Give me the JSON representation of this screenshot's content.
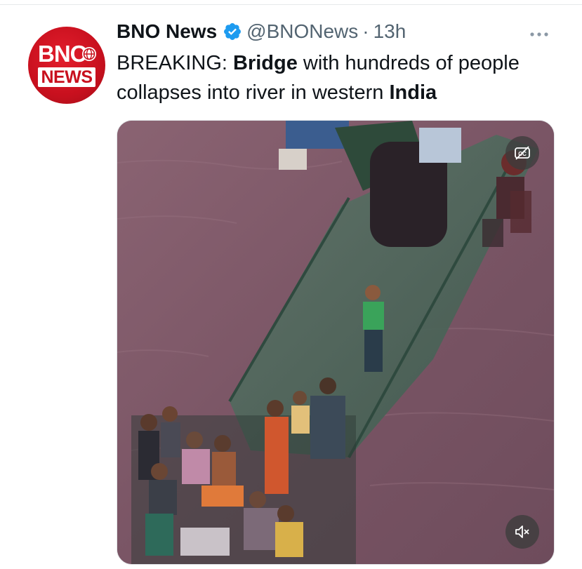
{
  "account": {
    "name": "BNO News",
    "handle": "@BNONews",
    "separator": "·",
    "time": "13h",
    "avatar_text_top": "BNO",
    "avatar_text_bottom": "NEWS",
    "brand_color": "#c8101e",
    "verified_color": "#1d9bf0"
  },
  "tweet": {
    "parts": [
      {
        "text": "BREAKING: ",
        "bold": false
      },
      {
        "text": "Bridge",
        "bold": true
      },
      {
        "text": " with hundreds of people collapses into river in western ",
        "bold": false
      },
      {
        "text": "India",
        "bold": true
      }
    ]
  },
  "media": {
    "type": "video",
    "description_icon": "captions-off-icon",
    "volume_icon": "muted-speaker-icon"
  },
  "icons": {
    "more": "more-horizontal-icon",
    "verified": "verified-badge-icon"
  }
}
